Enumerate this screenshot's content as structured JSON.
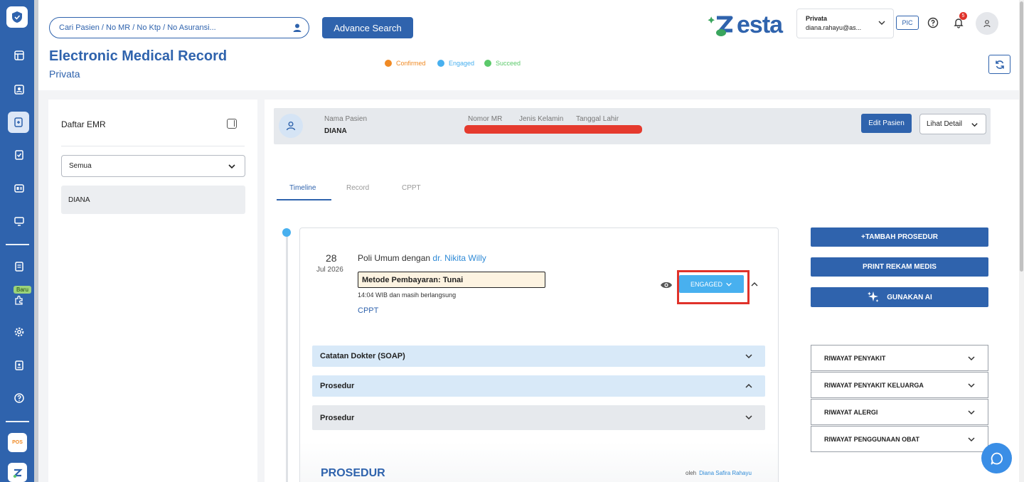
{
  "search": {
    "placeholder": "Cari Pasien / No MR / No Ktp / No Asuransi..."
  },
  "header": {
    "advance_search_label": "Advance Search",
    "title": "Electronic Medical Record",
    "subtitle": "Privata",
    "legend": [
      {
        "label": "Confirmed",
        "color": "#f08a24"
      },
      {
        "label": "Engaged",
        "color": "#48b0ef"
      },
      {
        "label": "Succeed",
        "color": "#5bc96a"
      }
    ],
    "brand": "esta",
    "account": {
      "name": "Privata",
      "email": "diana.rahayu@as..."
    },
    "pic_label": "PIC",
    "notification_count": "5"
  },
  "rail": {
    "new_badge": "Baru",
    "pos_app_label": "POS"
  },
  "sidebar": {
    "title": "Daftar EMR",
    "filter_value": "Semua",
    "patients": [
      "DIANA"
    ]
  },
  "patient_bar": {
    "name_label": "Nama Pasien",
    "name_value": "DIANA",
    "mr_label": "Nomor MR",
    "gender_label": "Jenis Kelamin",
    "dob_label": "Tanggal Lahir",
    "edit_label": "Edit Pasien",
    "detail_label": "Lihat Detail"
  },
  "tabs": [
    {
      "label": "Timeline",
      "active": true
    },
    {
      "label": "Record",
      "active": false
    },
    {
      "label": "CPPT",
      "active": false
    }
  ],
  "visit": {
    "day": "28",
    "month_year": "Jul 2026",
    "title_prefix": "Poli Umum dengan ",
    "doctor": "dr. Nikita Willy",
    "payment": "Metode Pembayaran: Tunai",
    "time_status": "14:04 WIB dan masih berlangsung",
    "cppt_link": "CPPT",
    "status_label": "ENGAGED",
    "sections": [
      {
        "label": "Catatan Dokter (SOAP)",
        "expanded": false,
        "bg": "#d8e9f8"
      },
      {
        "label": "Prosedur",
        "expanded": true,
        "bg": "#d8e9f8"
      },
      {
        "label": "Prosedur",
        "expanded": false,
        "bg": "#e6e9ed"
      }
    ],
    "procedure_heading": "PROSEDUR",
    "by_label": "oleh",
    "by_name": "Diana Safira Rahayu"
  },
  "actions": {
    "add_procedure": "+TAMBAH PROSEDUR",
    "print_record": "PRINT REKAM MEDIS",
    "use_ai": "GUNAKAN AI"
  },
  "history": [
    "RIWAYAT PENYAKIT",
    "RIWAYAT PENYAKIT KELUARGA",
    "RIWAYAT ALERGI",
    "RIWAYAT PENGGUNAAN OBAT"
  ],
  "colors": {
    "primary": "#2f63ad",
    "engaged": "#48b0ef",
    "highlight": "#e0322a"
  }
}
